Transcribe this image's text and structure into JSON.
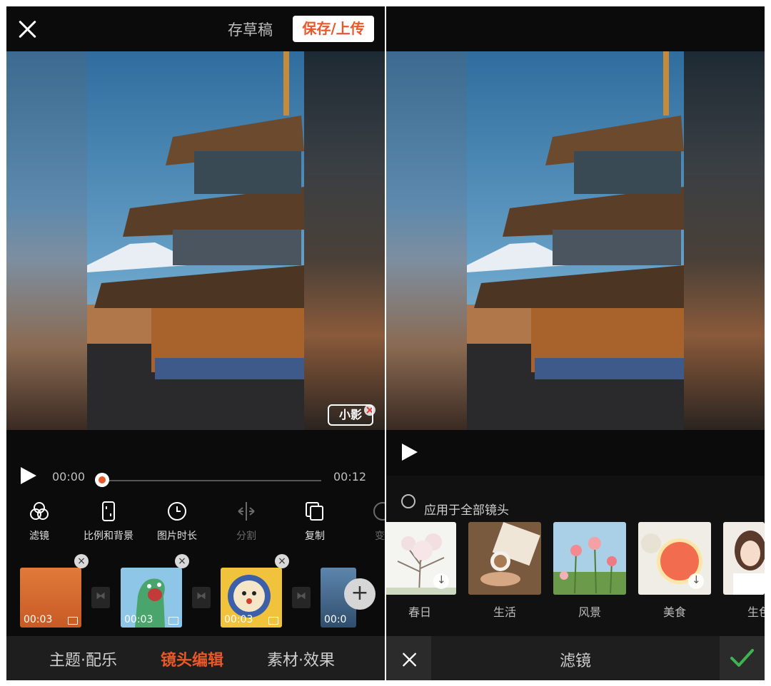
{
  "left": {
    "header": {
      "draft_label": "存草稿",
      "save_label": "保存/上传"
    },
    "player": {
      "current_time": "00:00",
      "total_time": "00:12",
      "progress": 0.0
    },
    "watermark": {
      "logo_text": "小影"
    },
    "tools": [
      {
        "label": "滤镜",
        "icon": "filter-icon",
        "enabled": true
      },
      {
        "label": "比例和背景",
        "icon": "aspect-ratio-icon",
        "enabled": true
      },
      {
        "label": "图片时长",
        "icon": "clock-icon",
        "enabled": true
      },
      {
        "label": "分割",
        "icon": "split-icon",
        "enabled": false
      },
      {
        "label": "复制",
        "icon": "copy-icon",
        "enabled": true
      },
      {
        "label": "变",
        "icon": "partial-tool-icon",
        "enabled": false
      }
    ],
    "clips": [
      {
        "duration": "00:03",
        "kind": "photo-orange"
      },
      {
        "duration": "00:03",
        "kind": "cartoon-dinosaur"
      },
      {
        "duration": "00:03",
        "kind": "cartoon-face"
      },
      {
        "duration": "00:0",
        "kind": "photo-blue"
      }
    ],
    "tabs": [
      {
        "label": "主题·配乐",
        "active": false
      },
      {
        "label": "镜头编辑",
        "active": true
      },
      {
        "label": "素材·效果",
        "active": false
      }
    ]
  },
  "right": {
    "apply_all_label": "应用于全部镜头",
    "filters": [
      {
        "label": "春日",
        "downloadable": true
      },
      {
        "label": "生活",
        "downloadable": false
      },
      {
        "label": "风景",
        "downloadable": false
      },
      {
        "label": "美食",
        "downloadable": true
      },
      {
        "label": "生色",
        "downloadable": false
      }
    ],
    "title": "滤镜"
  },
  "colors": {
    "accent": "#e8582a",
    "confirm": "#3fb34f",
    "panel_bg": "#0b0b0b",
    "tab_bg": "#1e1e1e"
  }
}
